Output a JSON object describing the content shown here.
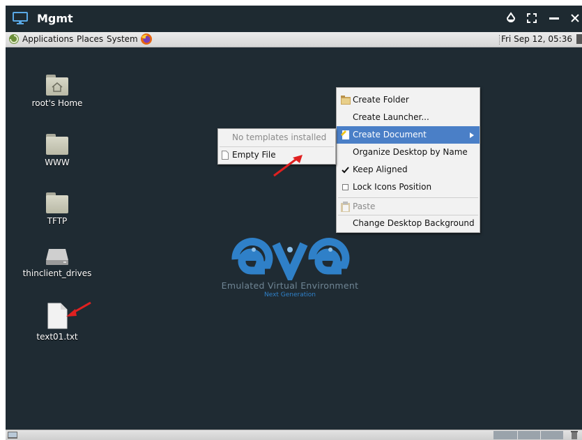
{
  "window": {
    "title": "Mgmt",
    "icon": "monitor-icon",
    "controls": [
      "drop-icon",
      "fullscreen-icon",
      "minimize-icon",
      "close-icon"
    ]
  },
  "panel": {
    "menus": [
      "Applications",
      "Places",
      "System"
    ],
    "clock": "Fri Sep 12, 05:36"
  },
  "desktop": {
    "icons": [
      {
        "label": "root's Home",
        "icon": "home-folder-icon"
      },
      {
        "label": "WWW",
        "icon": "folder-icon"
      },
      {
        "label": "TFTP",
        "icon": "folder-icon"
      },
      {
        "label": "thinclient_drives",
        "icon": "drive-icon"
      },
      {
        "label": "text01.txt",
        "icon": "text-file-icon"
      }
    ]
  },
  "logo": {
    "title": "eve",
    "line1": "Emulated Virtual Environment",
    "line2": "Next Generation"
  },
  "context_menu": {
    "items": [
      {
        "label": "Create Folder",
        "icon": "new-folder-icon"
      },
      {
        "label": "Create Launcher...",
        "icon": ""
      },
      {
        "label": "Create Document",
        "icon": "new-document-icon",
        "state": "highlighted",
        "submenu": true
      },
      {
        "label": "Organize Desktop by Name",
        "icon": ""
      },
      {
        "label": "Keep Aligned",
        "icon": "check-icon",
        "checked": true
      },
      {
        "label": "Lock Icons Position",
        "icon": "checkbox-icon",
        "checked": false
      },
      {
        "label": "Paste",
        "icon": "paste-icon",
        "disabled": true
      },
      {
        "label": "Change Desktop Background",
        "icon": ""
      }
    ]
  },
  "submenu": {
    "items": [
      {
        "label": "No templates installed",
        "disabled": true
      },
      {
        "label": "Empty File",
        "icon": "empty-file-icon"
      }
    ]
  },
  "colors": {
    "desktop_bg": "#1f2b33",
    "menu_highlight": "#4a7fc7",
    "logo_blue": "#2f80c8",
    "annotation_arrow": "#e02020"
  }
}
